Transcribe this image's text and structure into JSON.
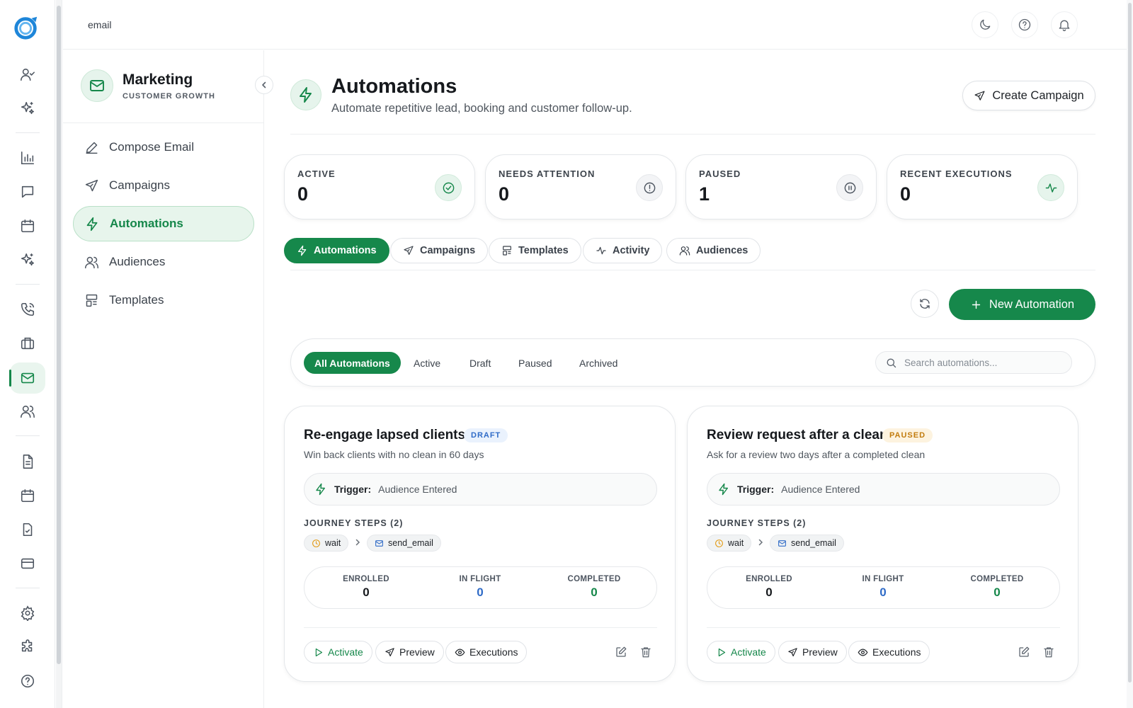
{
  "topbar": {
    "breadcrumb": "email",
    "icons": [
      "moon-icon",
      "help-icon",
      "bell-icon"
    ]
  },
  "rail": {
    "icons": [
      "contact-icon",
      "sparkles-icon",
      "chart-icon",
      "chat-icon",
      "calendar-icon",
      "sparkles-icon",
      "phone-icon",
      "briefcase-icon",
      "mail-icon",
      "users-icon",
      "document-icon",
      "calendar-icon",
      "clipboard-check-icon",
      "credit-card-icon",
      "gear-icon",
      "puzzle-icon",
      "help-icon"
    ],
    "active": "mail-icon"
  },
  "sidebar": {
    "title": "Marketing",
    "subtitle": "CUSTOMER GROWTH",
    "items": [
      {
        "label": "Compose Email",
        "icon": "pencil-icon"
      },
      {
        "label": "Campaigns",
        "icon": "send-icon"
      },
      {
        "label": "Automations",
        "icon": "bolt-icon",
        "active": true
      },
      {
        "label": "Audiences",
        "icon": "users-icon"
      },
      {
        "label": "Templates",
        "icon": "template-icon"
      }
    ]
  },
  "header": {
    "title": "Automations",
    "subtitle": "Automate repetitive lead, booking and customer follow-up.",
    "create_label": "Create Campaign"
  },
  "stats": [
    {
      "label": "ACTIVE",
      "value": "0",
      "icon": "check-circle-icon"
    },
    {
      "label": "NEEDS ATTENTION",
      "value": "0",
      "icon": "alert-circle-icon"
    },
    {
      "label": "PAUSED",
      "value": "1",
      "icon": "pause-circle-icon"
    },
    {
      "label": "RECENT EXECUTIONS",
      "value": "0",
      "icon": "activity-icon"
    }
  ],
  "tabs": [
    {
      "label": "Automations",
      "icon": "bolt-icon",
      "active": true
    },
    {
      "label": "Campaigns",
      "icon": "send-icon"
    },
    {
      "label": "Templates",
      "icon": "template-icon"
    },
    {
      "label": "Activity",
      "icon": "activity-icon"
    },
    {
      "label": "Audiences",
      "icon": "users-icon"
    }
  ],
  "toolbar": {
    "new_label": "New Automation"
  },
  "filters": {
    "pills": [
      "All Automations",
      "Active",
      "Draft",
      "Paused",
      "Archived"
    ],
    "active": "All Automations",
    "search_placeholder": "Search automations..."
  },
  "cards": [
    {
      "title": "Re-engage lapsed clients",
      "status": "DRAFT",
      "description": "Win back clients with no clean in 60 days",
      "trigger_label": "Trigger:",
      "trigger_value": "Audience Entered",
      "steps_label": "JOURNEY STEPS (2)",
      "steps": [
        "wait",
        "send_email"
      ],
      "metrics": [
        {
          "label": "ENROLLED",
          "value": "0"
        },
        {
          "label": "IN FLIGHT",
          "value": "0"
        },
        {
          "label": "COMPLETED",
          "value": "0"
        }
      ],
      "actions": [
        "Activate",
        "Preview",
        "Executions"
      ]
    },
    {
      "title": "Review request after a clean",
      "status": "PAUSED",
      "description": "Ask for a review two days after a completed clean",
      "trigger_label": "Trigger:",
      "trigger_value": "Audience Entered",
      "steps_label": "JOURNEY STEPS (2)",
      "steps": [
        "wait",
        "send_email"
      ],
      "metrics": [
        {
          "label": "ENROLLED",
          "value": "0"
        },
        {
          "label": "IN FLIGHT",
          "value": "0"
        },
        {
          "label": "COMPLETED",
          "value": "0"
        }
      ],
      "actions": [
        "Activate",
        "Preview",
        "Executions"
      ]
    }
  ],
  "colors": {
    "brand_green": "#16884b",
    "light_green": "#e7f5ec",
    "draft_blue": "#2f6bc7",
    "paused_amber": "#c27c0e",
    "in_flight_blue": "#2f6bc7",
    "completed_green": "#15874a"
  }
}
